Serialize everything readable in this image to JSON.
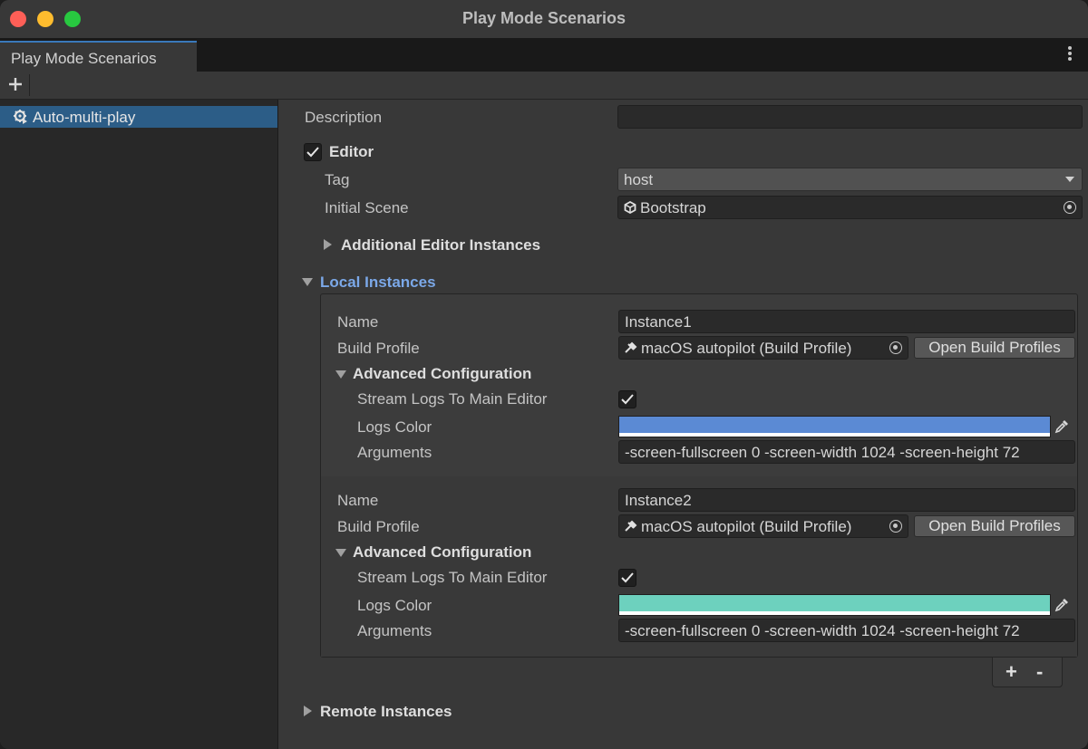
{
  "window": {
    "title": "Play Mode Scenarios"
  },
  "tab": {
    "label": "Play Mode Scenarios"
  },
  "sidebar": {
    "items": [
      {
        "label": "Auto-multi-play"
      }
    ]
  },
  "description": {
    "label": "Description",
    "value": ""
  },
  "editor": {
    "label": "Editor",
    "checked": true,
    "tag": {
      "label": "Tag",
      "value": "host"
    },
    "initial_scene": {
      "label": "Initial Scene",
      "value": "Bootstrap"
    },
    "additional": {
      "label": "Additional Editor Instances"
    }
  },
  "local_instances": {
    "label": "Local Instances",
    "instances": [
      {
        "name_label": "Name",
        "name": "Instance1",
        "build_profile_label": "Build Profile",
        "build_profile": "macOS autopilot (Build Profile)",
        "open_button": "Open Build Profiles",
        "advanced_label": "Advanced Configuration",
        "stream_logs_label": "Stream Logs To Main Editor",
        "stream_logs": true,
        "logs_color_label": "Logs Color",
        "logs_color": "#5b8ad4",
        "arguments_label": "Arguments",
        "arguments": "-screen-fullscreen 0 -screen-width 1024 -screen-height 72"
      },
      {
        "name_label": "Name",
        "name": "Instance2",
        "build_profile_label": "Build Profile",
        "build_profile": "macOS autopilot (Build Profile)",
        "open_button": "Open Build Profiles",
        "advanced_label": "Advanced Configuration",
        "stream_logs_label": "Stream Logs To Main Editor",
        "stream_logs": true,
        "logs_color_label": "Logs Color",
        "logs_color": "#6dd1be",
        "arguments_label": "Arguments",
        "arguments": "-screen-fullscreen 0 -screen-width 1024 -screen-height 72"
      }
    ],
    "add_label": "+",
    "remove_label": "-"
  },
  "remote_instances": {
    "label": "Remote Instances"
  }
}
